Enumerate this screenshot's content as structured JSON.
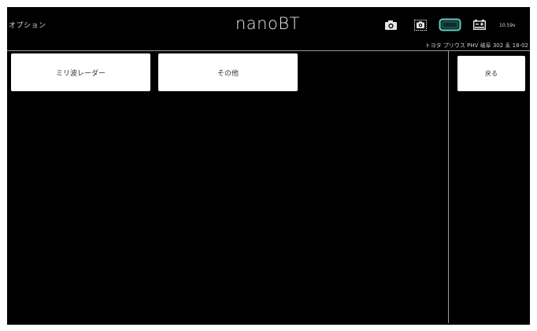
{
  "header": {
    "menu_title": "オプション",
    "logo": "nanoBT",
    "voltage": "10.59v",
    "vehicle": "トヨタ プリウス PHV 岐阜 302 ゑ 18-02"
  },
  "icons": {
    "camera": "camera-icon",
    "screenshot": "screenshot-camera-icon",
    "connection": "connection-status-icon",
    "battery": "battery-icon"
  },
  "colors": {
    "background": "#000000",
    "button_background": "#ffffff",
    "accent": "#5fc9c0",
    "divider": "#9a9a9a"
  },
  "buttons": {
    "radar": "ミリ波レーダー",
    "other": "その他",
    "back": "戻る"
  }
}
